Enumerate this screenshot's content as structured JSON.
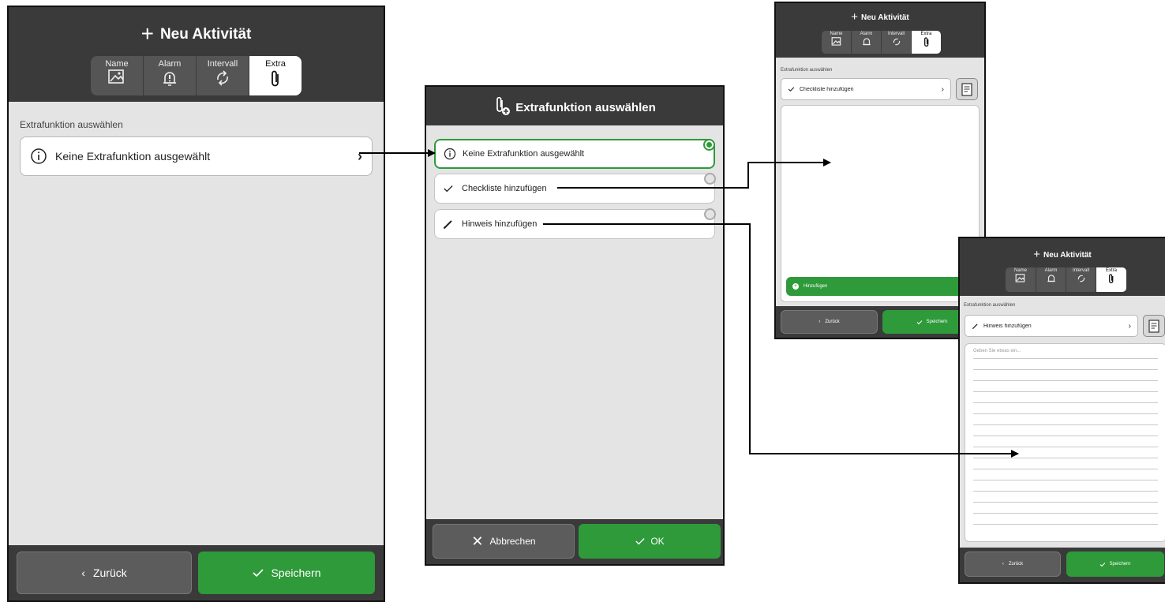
{
  "header": {
    "title": "Neu Aktivität"
  },
  "tabs": [
    {
      "label": "Name",
      "icon": "image-icon"
    },
    {
      "label": "Alarm",
      "icon": "alarm-icon"
    },
    {
      "label": "Intervall",
      "icon": "repeat-icon"
    },
    {
      "label": "Extra",
      "icon": "paperclip-icon"
    }
  ],
  "main": {
    "section_label": "Extrafunktion auswählen",
    "selection": "Keine Extrafunktion ausgewählt",
    "back_label": "Zurück",
    "save_label": "Speichern"
  },
  "dialog": {
    "title": "Extrafunktion auswählen",
    "options": [
      {
        "label": "Keine Extrafunktion ausgewählt",
        "icon": "info-icon",
        "selected": true
      },
      {
        "label": "Checkliste hinzufügen",
        "icon": "check-icon",
        "selected": false
      },
      {
        "label": "Hinweis hinzufügen",
        "icon": "pencil-icon",
        "selected": false
      }
    ],
    "cancel_label": "Abbrechen",
    "ok_label": "OK"
  },
  "checklist_screen": {
    "section_label": "Extrafunktion auswählen",
    "selection": "Checkliste hinzufügen",
    "add_label": "Hinzufügen",
    "back_label": "Zurück",
    "save_label": "Speichern"
  },
  "note_screen": {
    "section_label": "Extrafunktion auswählen",
    "selection": "Hinweis hinzufügen",
    "placeholder": "Geben Sie etwas ein...",
    "back_label": "Zurück",
    "save_label": "Speichern"
  },
  "colors": {
    "header": "#3a3a3a",
    "accent_green": "#2e9a3a",
    "panel_bg": "#e4e4e4",
    "button_grey": "#5c5c5c"
  }
}
